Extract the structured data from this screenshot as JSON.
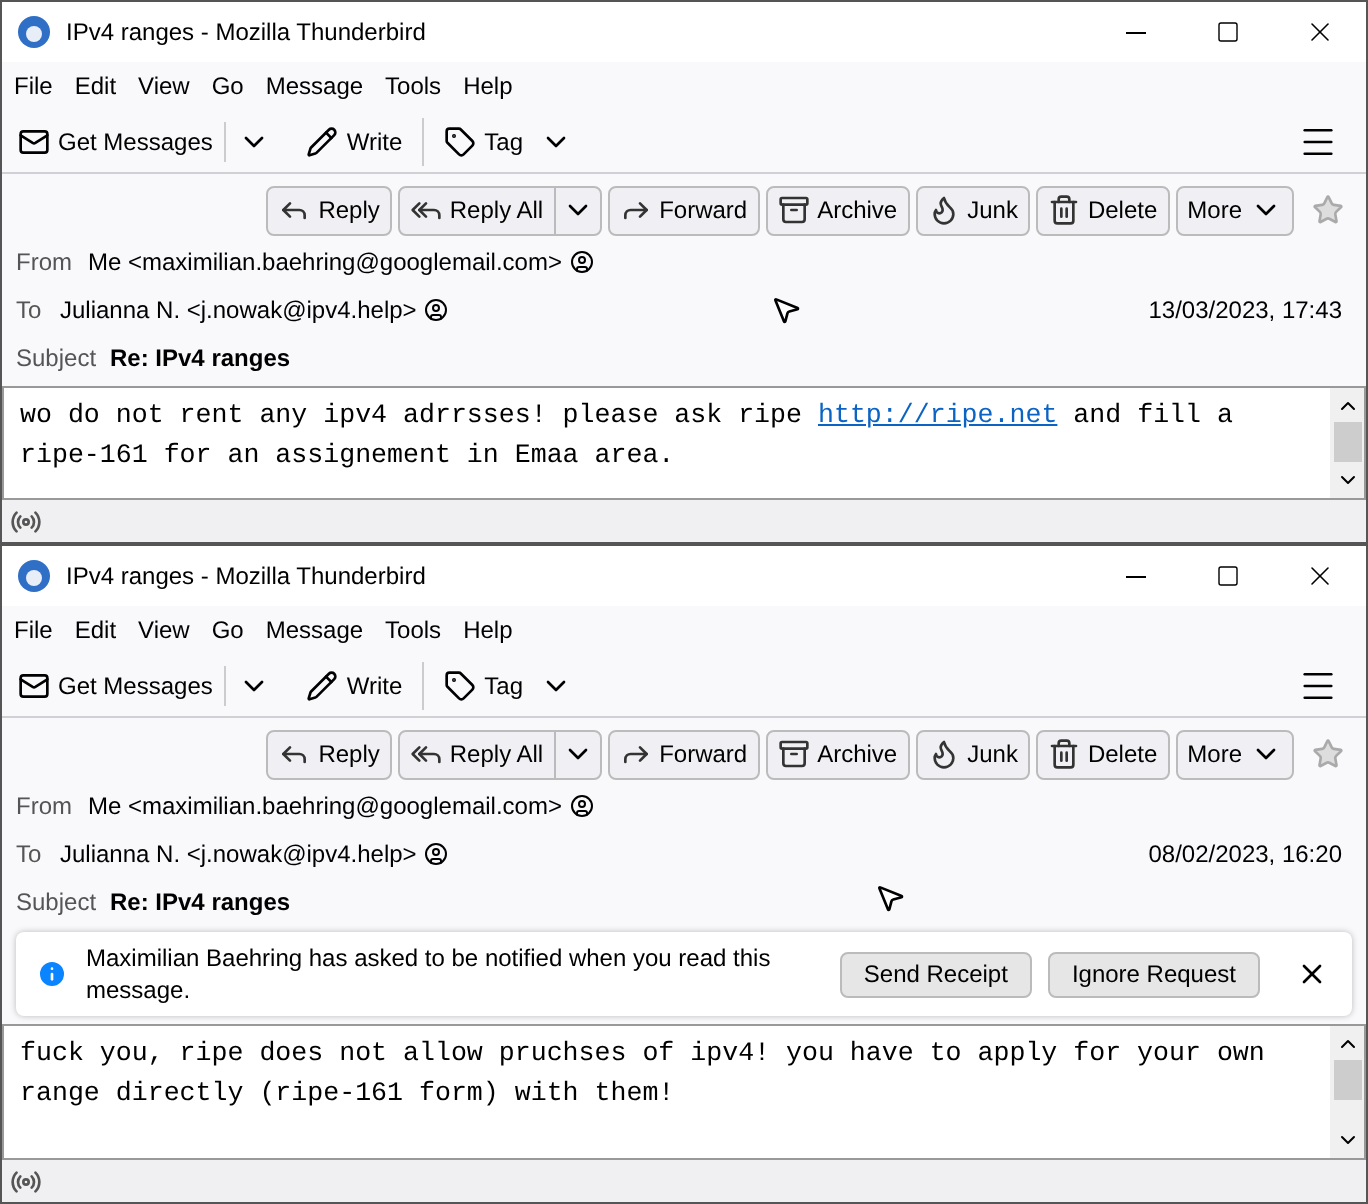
{
  "windows": [
    {
      "title": "IPv4 ranges - Mozilla Thunderbird",
      "menu": [
        "File",
        "Edit",
        "View",
        "Go",
        "Message",
        "Tools",
        "Help"
      ],
      "toolbar": {
        "get_messages": "Get Messages",
        "write": "Write",
        "tag": "Tag"
      },
      "actions": [
        {
          "kind": "reply",
          "label": "Reply"
        },
        {
          "kind": "reply-all",
          "label": "Reply All"
        },
        {
          "kind": "forward",
          "label": "Forward"
        },
        {
          "kind": "archive",
          "label": "Archive"
        },
        {
          "kind": "junk",
          "label": "Junk"
        },
        {
          "kind": "delete",
          "label": "Delete"
        },
        {
          "kind": "more",
          "label": "More"
        }
      ],
      "from": {
        "label": "From",
        "value": "Me <maximilian.baehring@googlemail.com>"
      },
      "to": {
        "label": "To",
        "value": "Julianna N. <j.nowak@ipv4.help>"
      },
      "date": "13/03/2023, 17:43",
      "subject": {
        "label": "Subject",
        "value": "Re: IPv4 ranges"
      },
      "body": [
        {
          "kind": "text",
          "text": "wo do not rent any ipv4 adrrsses! please ask ripe "
        },
        {
          "kind": "link",
          "text": "http://ripe.net"
        },
        {
          "kind": "text",
          "text": " and fill a ripe-161 for an assignement in Emaa area."
        }
      ]
    },
    {
      "title": "IPv4 ranges - Mozilla Thunderbird",
      "menu": [
        "File",
        "Edit",
        "View",
        "Go",
        "Message",
        "Tools",
        "Help"
      ],
      "toolbar": {
        "get_messages": "Get Messages",
        "write": "Write",
        "tag": "Tag"
      },
      "actions": [
        {
          "kind": "reply",
          "label": "Reply"
        },
        {
          "kind": "reply-all",
          "label": "Reply All"
        },
        {
          "kind": "forward",
          "label": "Forward"
        },
        {
          "kind": "archive",
          "label": "Archive"
        },
        {
          "kind": "junk",
          "label": "Junk"
        },
        {
          "kind": "delete",
          "label": "Delete"
        },
        {
          "kind": "more",
          "label": "More"
        }
      ],
      "from": {
        "label": "From",
        "value": "Me <maximilian.baehring@googlemail.com>"
      },
      "to": {
        "label": "To",
        "value": "Julianna N. <j.nowak@ipv4.help>"
      },
      "date": "08/02/2023, 16:20",
      "subject": {
        "label": "Subject",
        "value": "Re: IPv4 ranges"
      },
      "notification": {
        "text": "Maximilian Baehring has asked to be notified when you read this message.",
        "buttons": [
          "Send Receipt",
          "Ignore Request"
        ]
      },
      "body": [
        {
          "kind": "text",
          "text": "fuck you, ripe does not allow pruchses of ipv4! you have to apply for your own range directly (ripe-161 form) with them!"
        }
      ]
    }
  ]
}
